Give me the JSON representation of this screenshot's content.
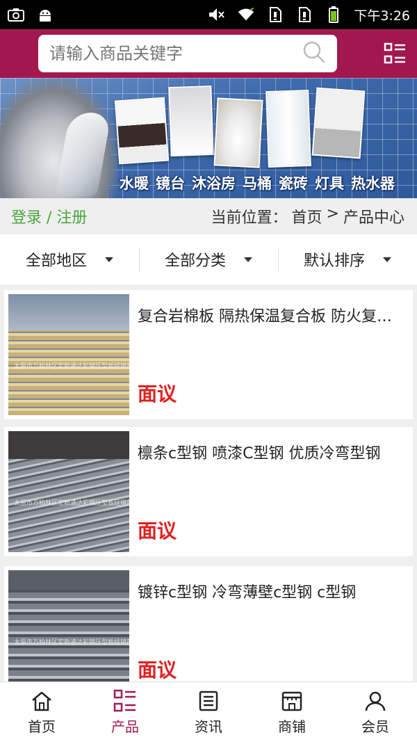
{
  "status_bar": {
    "time": "下午3:26",
    "icons": [
      "camera-icon",
      "android-icon",
      "mute-icon",
      "wifi-icon",
      "sim1-icon",
      "sim2-icon",
      "battery-icon"
    ]
  },
  "header": {
    "search_placeholder": "请输入商品关键字",
    "search_icon": "search-icon",
    "menu_icon": "grid-menu-icon",
    "accent_color": "#a3174f"
  },
  "banner": {
    "caption": [
      "水暖",
      "镜台",
      "沐浴房",
      "马桶",
      "瓷砖",
      "灯具",
      "热水器"
    ]
  },
  "location_bar": {
    "login_label": "登录 / 注册",
    "prefix": "当前位置：",
    "home": "首页",
    "separator": ">",
    "current": "产品中心"
  },
  "filters": [
    {
      "label": "全部地区"
    },
    {
      "label": "全部分类"
    },
    {
      "label": "默认排序"
    }
  ],
  "products": [
    {
      "title": "复合岩棉板 隔热保温复合板 防火复合板",
      "price": "面议",
      "watermark": "太原市万柏林区宏新通达彩钢压型板经销部"
    },
    {
      "title": "檩条c型钢 喷漆C型钢 优质冷弯型钢",
      "price": "面议",
      "watermark": "太原市万柏林区宏新通达彩钢压型板经销部"
    },
    {
      "title": "镀锌c型钢 冷弯薄壁c型钢 c型钢",
      "price": "面议",
      "watermark": "太原市万柏林区宏新通达彩钢压型板经销部"
    }
  ],
  "bottom_nav": [
    {
      "label": "首页",
      "icon": "home-icon",
      "active": false
    },
    {
      "label": "产品",
      "icon": "list-icon",
      "active": true
    },
    {
      "label": "资讯",
      "icon": "news-icon",
      "active": false
    },
    {
      "label": "商铺",
      "icon": "shop-icon",
      "active": false
    },
    {
      "label": "会员",
      "icon": "user-icon",
      "active": false
    }
  ]
}
